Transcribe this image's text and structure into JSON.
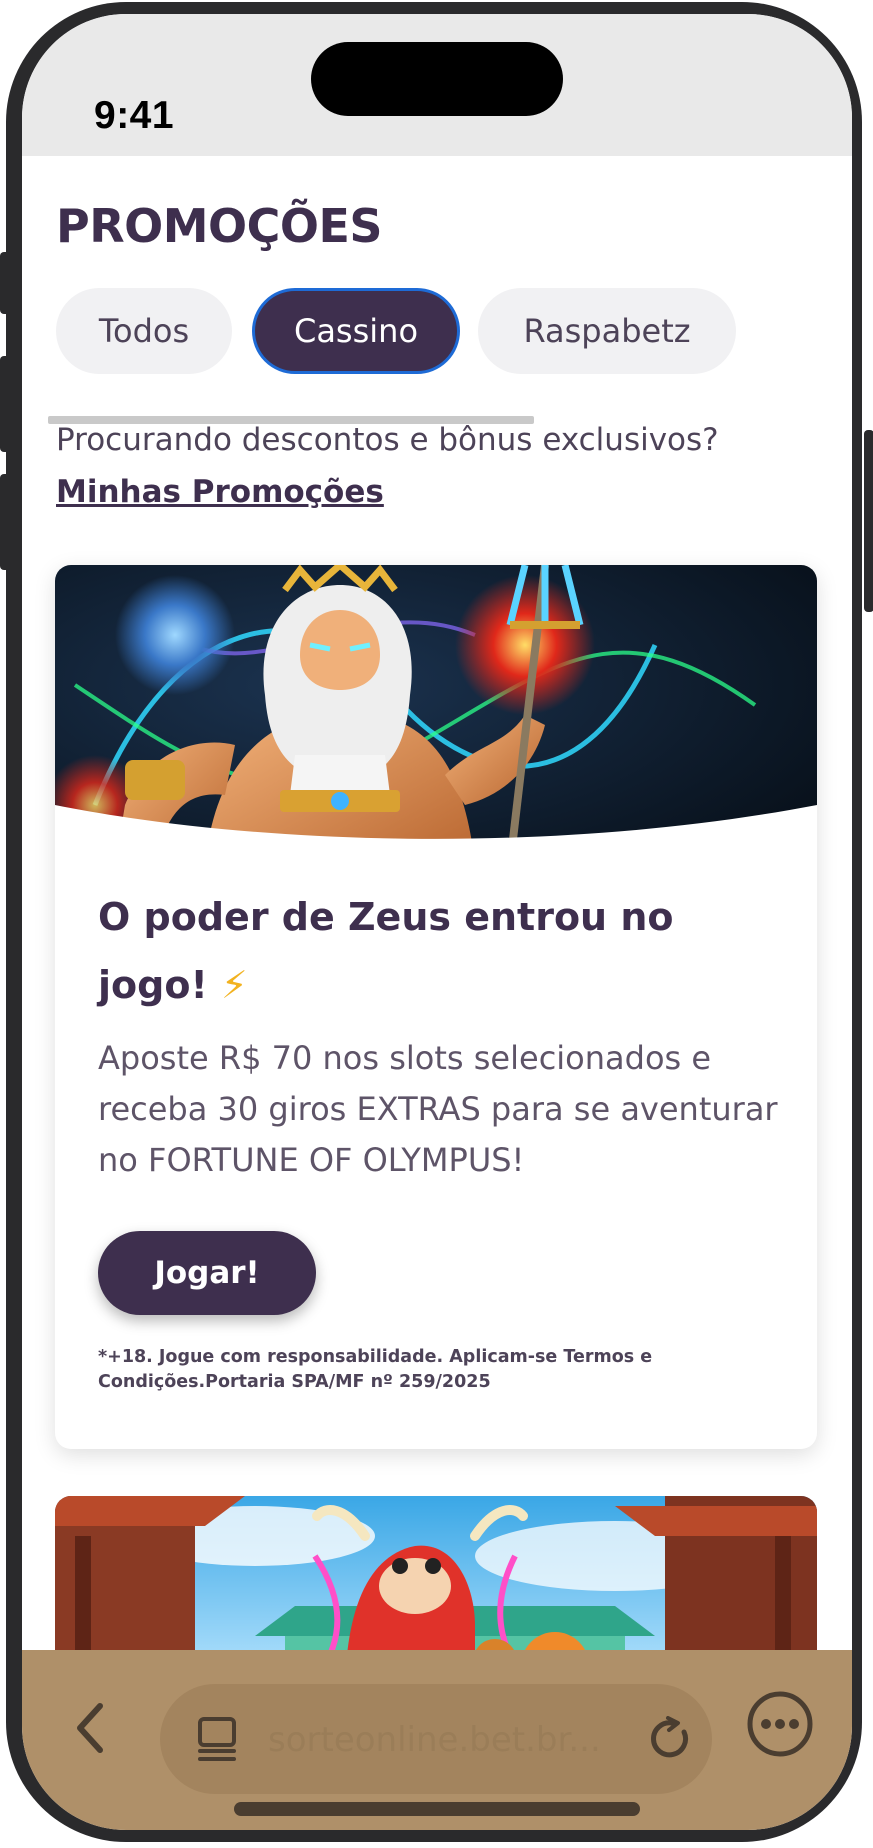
{
  "status_bar": {
    "time": "9:41"
  },
  "page": {
    "title": "PROMOÇÕES",
    "tabs": [
      {
        "label": "Todos",
        "active": false
      },
      {
        "label": "Cassino",
        "active": true
      },
      {
        "label": "Raspabetz",
        "active": false
      }
    ],
    "promo_question": "Procurando descontos e bônus exclusivos?",
    "promo_link": "Minhas Promoções"
  },
  "card": {
    "image": "zeus-banner",
    "title": "O poder de Zeus entrou no jogo!",
    "title_emoji": "⚡",
    "description": "Aposte R$ 70 nos slots selecionados e receba 30 giros EXTRAS para se aventurar no FORTUNE OF OLYMPUS!",
    "button_label": "Jogar!",
    "disclaimer": "*+18. Jogue com responsabilidade. Aplicam-se Termos e Condições.Portaria SPA/MF nº 259/2025"
  },
  "card2": {
    "image": "fortune-ox-banner"
  },
  "browser": {
    "url": "sorteonline.bet.br...",
    "icons": [
      "back-icon",
      "reader-icon",
      "reload-icon",
      "more-icon"
    ]
  },
  "colors": {
    "primary": "#3e2f4e",
    "active_tab_border": "#1e6bd6",
    "browser_bar": "#af9069",
    "url_field": "#a3845e"
  }
}
